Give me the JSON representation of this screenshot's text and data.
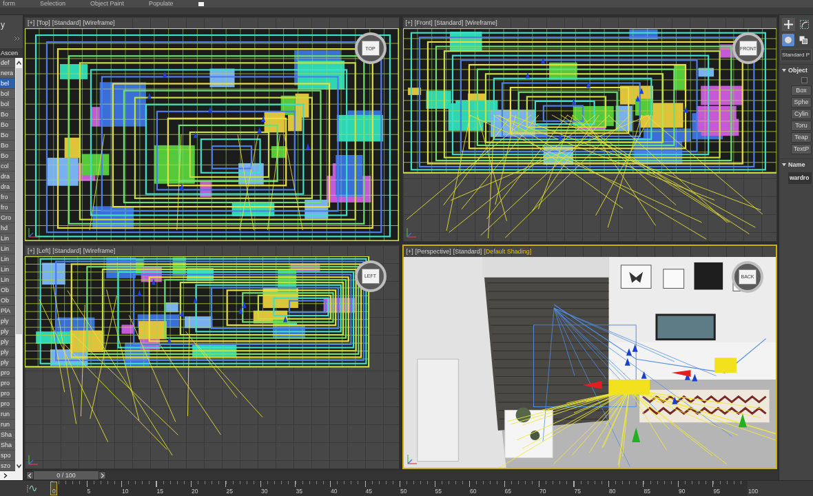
{
  "ribbon_tabs": [
    {
      "label": "form"
    },
    {
      "label": "Selection"
    },
    {
      "label": "Object Paint"
    },
    {
      "label": "Populate"
    }
  ],
  "scene_explorer": {
    "title": "y",
    "sort_header": "Ascen",
    "items": [
      {
        "label": "def",
        "selected": false
      },
      {
        "label": "nera",
        "selected": false
      },
      {
        "label": "bel",
        "selected": true
      },
      {
        "label": "bol",
        "selected": false
      },
      {
        "label": "bol",
        "selected": false
      },
      {
        "label": "Bo",
        "selected": false
      },
      {
        "label": "Bo",
        "selected": false
      },
      {
        "label": "Bo",
        "selected": false
      },
      {
        "label": "Bo",
        "selected": false
      },
      {
        "label": "Bo",
        "selected": false
      },
      {
        "label": "col",
        "selected": false
      },
      {
        "label": "dra",
        "selected": false
      },
      {
        "label": "dra",
        "selected": false
      },
      {
        "label": "fro",
        "selected": false
      },
      {
        "label": "fro",
        "selected": false
      },
      {
        "label": "Gro",
        "selected": false
      },
      {
        "label": "hd",
        "selected": false
      },
      {
        "label": "Lin",
        "selected": false
      },
      {
        "label": "Lin",
        "selected": false
      },
      {
        "label": "Lin",
        "selected": false
      },
      {
        "label": "Lin",
        "selected": false
      },
      {
        "label": "Lin",
        "selected": false
      },
      {
        "label": "Ob",
        "selected": false
      },
      {
        "label": "Ob",
        "selected": false
      },
      {
        "label": "PlA",
        "selected": false
      },
      {
        "label": "ply",
        "selected": false
      },
      {
        "label": "ply",
        "selected": false
      },
      {
        "label": "ply",
        "selected": false
      },
      {
        "label": "ply",
        "selected": false
      },
      {
        "label": "ply",
        "selected": false
      },
      {
        "label": "pro",
        "selected": false
      },
      {
        "label": "pro",
        "selected": false
      },
      {
        "label": "pro",
        "selected": false
      },
      {
        "label": "pro",
        "selected": false
      },
      {
        "label": "run",
        "selected": false
      },
      {
        "label": "run",
        "selected": false
      },
      {
        "label": "Sha",
        "selected": false
      },
      {
        "label": "Sha",
        "selected": false
      },
      {
        "label": "spo",
        "selected": false
      },
      {
        "label": "szo",
        "selected": false
      }
    ]
  },
  "viewports": [
    {
      "kind": "wireframe",
      "menu": "[+]",
      "view": "[Top]",
      "style": "[Standard]",
      "shading": "[Wireframe]",
      "shading_highlighted": false,
      "active": false,
      "viewcube": "TOP"
    },
    {
      "kind": "wireframe",
      "menu": "[+]",
      "view": "[Front]",
      "style": "[Standard]",
      "shading": "[Wireframe]",
      "shading_highlighted": false,
      "active": false,
      "viewcube": "FRONT"
    },
    {
      "kind": "wireframe",
      "menu": "[+]",
      "view": "[Left]",
      "style": "[Standard]",
      "shading": "[Wireframe]",
      "shading_highlighted": false,
      "active": false,
      "viewcube": "LEFT"
    },
    {
      "kind": "shaded",
      "menu": "[+]",
      "view": "[Perspective]",
      "style": "[Standard]",
      "shading": "[Default Shading]",
      "shading_highlighted": true,
      "active": true,
      "viewcube": "BACK"
    }
  ],
  "time_slider": {
    "position": "0 / 100",
    "level": 0
  },
  "trackbar": {
    "frame_labels": [
      "0",
      "5",
      "10",
      "15",
      "20",
      "25",
      "30",
      "35",
      "40",
      "45",
      "50",
      "55",
      "60",
      "65",
      "70",
      "75",
      "80",
      "85",
      "90",
      "95",
      "100"
    ],
    "level": 0
  },
  "command_panel": {
    "tabs": [
      {
        "kind": "create",
        "selected": true
      },
      {
        "kind": "modify",
        "selected": false
      }
    ],
    "categories": [
      {
        "kind": "geometry",
        "selected": true
      },
      {
        "kind": "shapes",
        "selected": false
      }
    ],
    "dropdown": "Standard P",
    "rollouts": [
      {
        "kind": "buttons",
        "title": "Object",
        "expanded": true,
        "checkbox": {
          "checked": false
        },
        "buttons": [
          "Box",
          "Sphe",
          "Cylin",
          "Toru",
          "Teap",
          "TextP"
        ]
      },
      {
        "kind": "field",
        "title": "Name",
        "expanded": true,
        "value": "wardro"
      }
    ]
  }
}
